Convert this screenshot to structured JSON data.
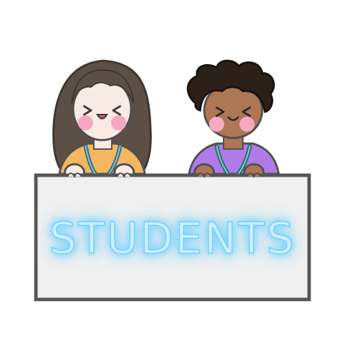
{
  "sign": {
    "label": "STUDENTS"
  },
  "characters": [
    {
      "name": "student-girl",
      "hair_color": "#5b4f46",
      "skin_color": "#f7ebe3",
      "shirt_color": "#f4b65f"
    },
    {
      "name": "student-boy",
      "hair_color": "#2c2119",
      "skin_color": "#ad7654",
      "shirt_color": "#b07be9"
    }
  ],
  "colors": {
    "sign_fill": "#f0f0f0",
    "sign_border": "#555555",
    "text_glow": "#6ccfff",
    "blush": "#f6a8c0"
  }
}
